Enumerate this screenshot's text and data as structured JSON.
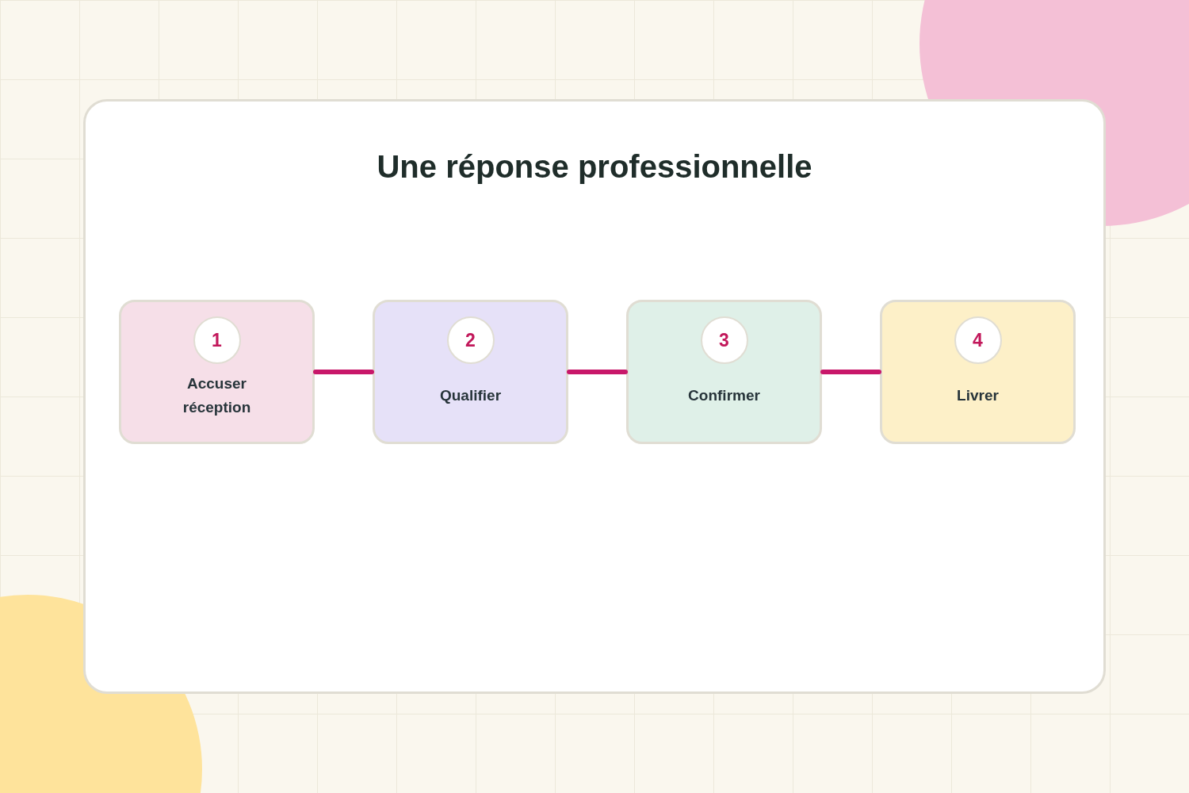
{
  "title": "Une réponse professionnelle",
  "steps": [
    {
      "number": "1",
      "label": "Accuser réception",
      "color": "#f6dfe8"
    },
    {
      "number": "2",
      "label": "Qualifier",
      "color": "#e6e1f8"
    },
    {
      "number": "3",
      "label": "Confirmer",
      "color": "#dff0e8"
    },
    {
      "number": "4",
      "label": "Livrer",
      "color": "#fdf0c8"
    }
  ]
}
